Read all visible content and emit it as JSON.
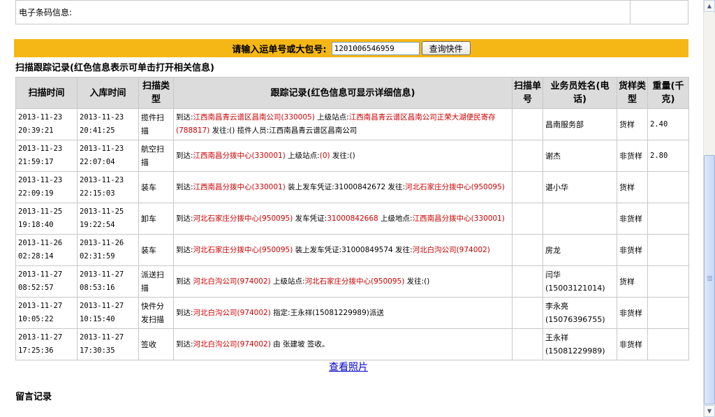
{
  "info": {
    "label": "电子条码信息:",
    "value": ""
  },
  "query": {
    "label": "请输入运单号或大包号:",
    "value": "1201006546959",
    "button": "查询快件"
  },
  "tracking": {
    "title": "扫描跟踪记录(红色信息表示可单击打开相关信息)",
    "headers": {
      "scan_time": "扫描时间",
      "in_time": "入库时间",
      "scan_type": "扫描类型",
      "record": "跟踪记录(红色信息可显示详细信息)",
      "scan_no": "扫描单号",
      "staff": "业务员姓名(电话)",
      "sample": "货样类型",
      "weight": "重量(千克)"
    },
    "rows": [
      {
        "scan_date": "2013-11-23",
        "scan_clock": "20:39:21",
        "in_date": "2013-11-23",
        "in_clock": "20:41:25",
        "type": "揽件扫描",
        "record": [
          {
            "t": "到达:"
          },
          {
            "t": "江西南昌青云谱区昌南公司(330005)",
            "r": 1
          },
          {
            "t": " 上级站点:"
          },
          {
            "t": "江西南昌青云谱区昌南公司正荣大湖便民寄存(788817)",
            "r": 1
          },
          {
            "t": " 发往:() 揽件人员:江西南昌青云谱区昌南公司"
          }
        ],
        "scan_no": "",
        "staff": "昌南服务部",
        "sample": "货样",
        "weight": "2.40"
      },
      {
        "scan_date": "2013-11-23",
        "scan_clock": "21:59:17",
        "in_date": "2013-11-23",
        "in_clock": "22:07:04",
        "type": "航空扫描",
        "record": [
          {
            "t": "到达:"
          },
          {
            "t": "江西南昌分拨中心(330001)",
            "r": 1
          },
          {
            "t": " 上级站点:"
          },
          {
            "t": "(0)",
            "r": 1
          },
          {
            "t": " 发往:()"
          }
        ],
        "scan_no": "",
        "staff": "谢杰",
        "sample": "非货样",
        "weight": "2.80"
      },
      {
        "scan_date": "2013-11-23",
        "scan_clock": "22:09:19",
        "in_date": "2013-11-23",
        "in_clock": "22:15:03",
        "type": "装车",
        "record": [
          {
            "t": "到达:"
          },
          {
            "t": "江西南昌分拨中心(330001)",
            "r": 1
          },
          {
            "t": " 装上发车凭证:31000842672 发往:"
          },
          {
            "t": "河北石家庄分拨中心(950095)",
            "r": 1
          }
        ],
        "scan_no": "",
        "staff": "谌小华",
        "sample": "货样",
        "weight": ""
      },
      {
        "scan_date": "2013-11-25",
        "scan_clock": "19:18:40",
        "in_date": "2013-11-25",
        "in_clock": "19:22:54",
        "type": "卸车",
        "record": [
          {
            "t": "到达:"
          },
          {
            "t": "河北石家庄分拨中心(950095)",
            "r": 1
          },
          {
            "t": " 发车凭证:"
          },
          {
            "t": "31000842668",
            "r": 1
          },
          {
            "t": " 上级地点:"
          },
          {
            "t": "江西南昌分拨中心(330001)",
            "r": 1
          }
        ],
        "scan_no": "",
        "staff": "",
        "sample": "非货样",
        "weight": ""
      },
      {
        "scan_date": "2013-11-26",
        "scan_clock": "02:28:14",
        "in_date": "2013-11-26",
        "in_clock": "02:31:59",
        "type": "装车",
        "record": [
          {
            "t": "到达:"
          },
          {
            "t": "河北石家庄分拨中心(950095)",
            "r": 1
          },
          {
            "t": " 装上发车凭证:31000849574 发往:"
          },
          {
            "t": "河北白沟公司(974002)",
            "r": 1
          }
        ],
        "scan_no": "",
        "staff": "房龙",
        "sample": "非货样",
        "weight": ""
      },
      {
        "scan_date": "2013-11-27",
        "scan_clock": "08:52:57",
        "in_date": "2013-11-27",
        "in_clock": "08:53:16",
        "type": "派送扫描",
        "record": [
          {
            "t": "到达 "
          },
          {
            "t": "河北白沟公司(974002)",
            "r": 1
          },
          {
            "t": " 上级站点:"
          },
          {
            "t": "河北石家庄分拨中心(950095)",
            "r": 1
          },
          {
            "t": " 发往:()"
          }
        ],
        "scan_no": "",
        "staff": "闫华(15003121014)",
        "sample": "货样",
        "weight": ""
      },
      {
        "scan_date": "2013-11-27",
        "scan_clock": "10:05:22",
        "in_date": "2013-11-27",
        "in_clock": "10:15:40",
        "type": "快件分发扫描",
        "record": [
          {
            "t": "到达:"
          },
          {
            "t": "河北白沟公司(974002)",
            "r": 1
          },
          {
            "t": " 指定:王永祥(15081229989)派送"
          }
        ],
        "scan_no": "",
        "staff": "李永亮(15076396755)",
        "sample": "非货样",
        "weight": ""
      },
      {
        "scan_date": "2013-11-27",
        "scan_clock": "17:25:36",
        "in_date": "2013-11-27",
        "in_clock": "17:30:35",
        "type": "签收",
        "record": [
          {
            "t": "到达:"
          },
          {
            "t": "河北白沟公司(974002)",
            "r": 1
          },
          {
            "t": " 由 张建坡 签收。"
          }
        ],
        "scan_no": "",
        "staff": "王永祥(15081229989)",
        "sample": "非货样",
        "weight": ""
      }
    ]
  },
  "photo_link": "查看照片",
  "message_title": "留言记录",
  "icons": {
    "scroll_up": "scroll-up-arrow-icon",
    "scroll_down": "scroll-down-arrow-icon"
  }
}
